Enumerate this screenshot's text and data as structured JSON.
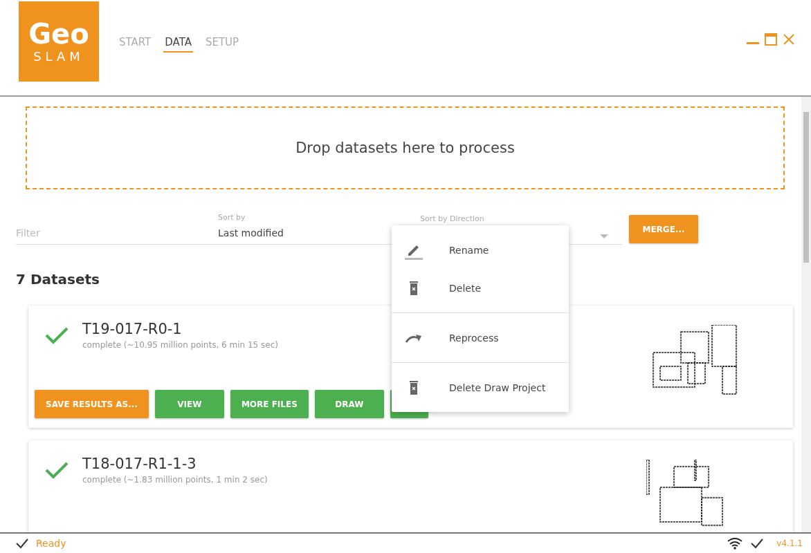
{
  "logo": {
    "top": "Geo",
    "bottom": "SLAM"
  },
  "tabs": [
    {
      "label": "START",
      "selected": false
    },
    {
      "label": "DATA",
      "selected": true
    },
    {
      "label": "SETUP",
      "selected": false
    }
  ],
  "dropzone": {
    "text": "Drop datasets here to process"
  },
  "filter": {
    "placeholder": "Filter"
  },
  "sort_by": {
    "label": "Sort by",
    "value": "Last modified"
  },
  "sort_direction": {
    "label": "Sort by Direction"
  },
  "merge_button": "MERGE...",
  "count_heading": "7 Datasets",
  "datasets": [
    {
      "name": "T19-017-R0-1",
      "status": "complete (~10.95 million points, 6 min 15 sec)",
      "complete": true,
      "buttons": [
        {
          "label": "SAVE RESULTS AS...",
          "kind": "primary"
        },
        {
          "label": "VIEW",
          "kind": "action"
        },
        {
          "label": "MORE FILES",
          "kind": "action"
        },
        {
          "label": "DRAW",
          "kind": "action"
        },
        {
          "kind": "more"
        }
      ]
    },
    {
      "name": "T18-017-R1-1-3",
      "status": "complete (~1.83 million points, 1 min 2 sec)",
      "complete": true
    }
  ],
  "context_menu": [
    {
      "label": "Rename",
      "kind": "rename",
      "divider_before": false
    },
    {
      "label": "Delete",
      "kind": "delete",
      "divider_before": false
    },
    {
      "label": "Reprocess",
      "kind": "reprocess",
      "divider_before": true
    },
    {
      "label": "Delete Draw Project",
      "kind": "delete",
      "divider_before": true
    }
  ],
  "status_bar": {
    "status": "Ready",
    "version": "v4.1.1"
  }
}
